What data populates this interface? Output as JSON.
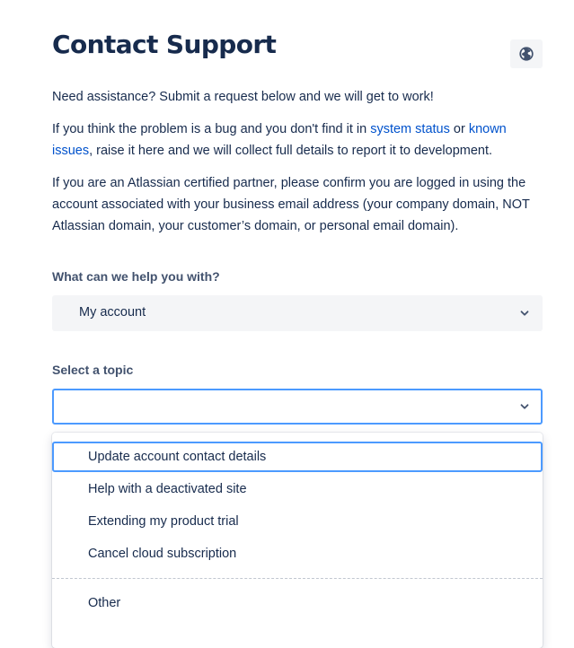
{
  "header": {
    "title": "Contact Support",
    "globe_icon": "globe-icon"
  },
  "intro": {
    "p1": "Need assistance? Submit a request below and we will get to work!",
    "p2_before": "If you think the problem is a bug and you don't find it in ",
    "p2_link1": "system status",
    "p2_mid": " or ",
    "p2_link2": "known issues",
    "p2_after": ", raise it here and we will collect full details to report it to development.",
    "p3": "If you are an Atlassian certified partner, please confirm you are logged in using the account associated with your business email address (your company domain, NOT Atlassian domain, your customer’s domain, or personal email domain)."
  },
  "help": {
    "label": "What can we help you with?",
    "value": "My account"
  },
  "topic": {
    "label": "Select a topic",
    "value": "",
    "options": [
      "Update account contact details",
      "Help with a deactivated site",
      "Extending my product trial",
      "Cancel cloud subscription",
      "Other"
    ]
  },
  "colors": {
    "link": "#0052cc",
    "focus": "#4c9aff",
    "text": "#172b4d",
    "muted": "#42526e"
  }
}
